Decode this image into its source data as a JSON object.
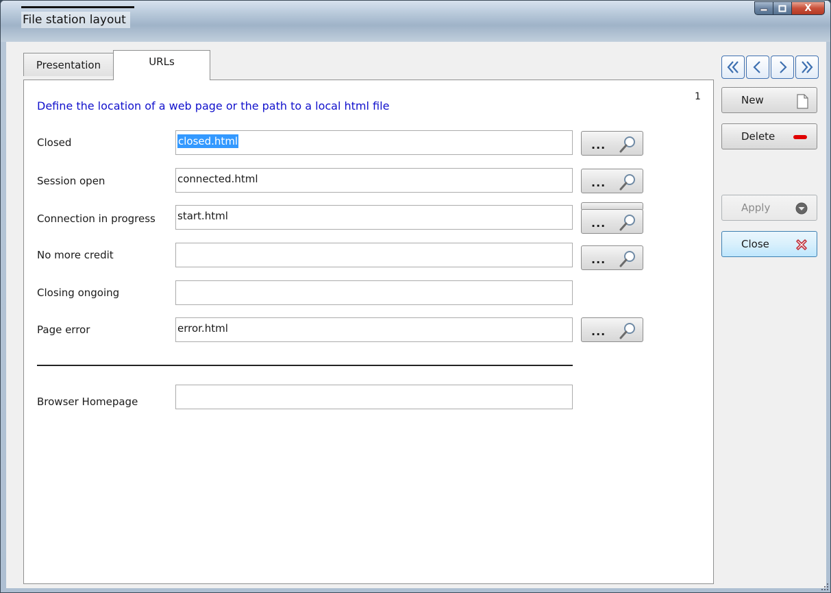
{
  "window": {
    "title": "File station layout",
    "controls": {
      "minimize": "–",
      "maximize": "□",
      "close": "X"
    }
  },
  "tabs": [
    {
      "label": "Presentation",
      "active": false
    },
    {
      "label": "URLs",
      "active": true
    }
  ],
  "page_number": "1",
  "headline": "Define the location of a web page or the path to a local html file",
  "url_rows": [
    {
      "label": "Closed",
      "value": "closed.html",
      "selected": true,
      "has_browse": true
    },
    {
      "label": "Session open",
      "value": "connected.html",
      "has_browse": true
    },
    {
      "label": "Connection in progress",
      "value": "start.html",
      "has_browse": true
    },
    {
      "label": "No more credit",
      "value": "",
      "has_browse": true
    },
    {
      "label": "Closing ongoing",
      "value": "",
      "has_browse": false
    },
    {
      "label": "Page error",
      "value": "error.html",
      "has_browse": true
    }
  ],
  "browse_label": "...",
  "homepage": {
    "label": "Browser Homepage",
    "value": ""
  },
  "toolbar": {
    "nav_icons": [
      "first-icon",
      "previous-icon",
      "next-icon",
      "last-icon"
    ],
    "new_label": "New",
    "delete_label": "Delete",
    "apply_label": "Apply",
    "close_label": "Close"
  },
  "colors": {
    "headline": "#1010cc",
    "selection": "#3399ff",
    "delete_indicator": "#e00000",
    "close_icon": "#c0303a",
    "nav_accent": "#3d6fb0"
  }
}
